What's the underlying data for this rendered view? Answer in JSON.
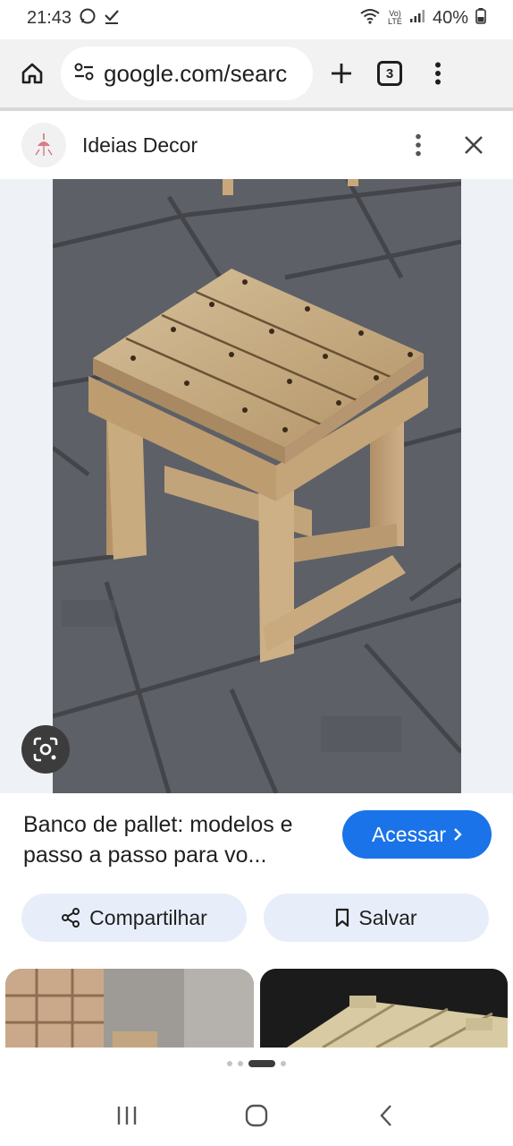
{
  "status_bar": {
    "time": "21:43",
    "battery": "40%",
    "network": "Vo) LTE"
  },
  "browser": {
    "url": "google.com/searc",
    "tab_count": "3",
    "icons": [
      "home-icon",
      "site-info-icon",
      "new-tab-icon",
      "tab-switcher-icon",
      "menu-icon"
    ]
  },
  "source": {
    "name": "Ideias Decor"
  },
  "result": {
    "title": "Banco de pallet: modelos e passo a passo para vo...",
    "visit_label": "Acessar",
    "share_label": "Compartilhar",
    "save_label": "Salvar"
  },
  "colors": {
    "accent": "#1a73e8",
    "pill_bg": "#e8eef9",
    "toolbar_bg": "#f2f2f2"
  },
  "pagination": {
    "active_index": 2,
    "total": 4
  }
}
